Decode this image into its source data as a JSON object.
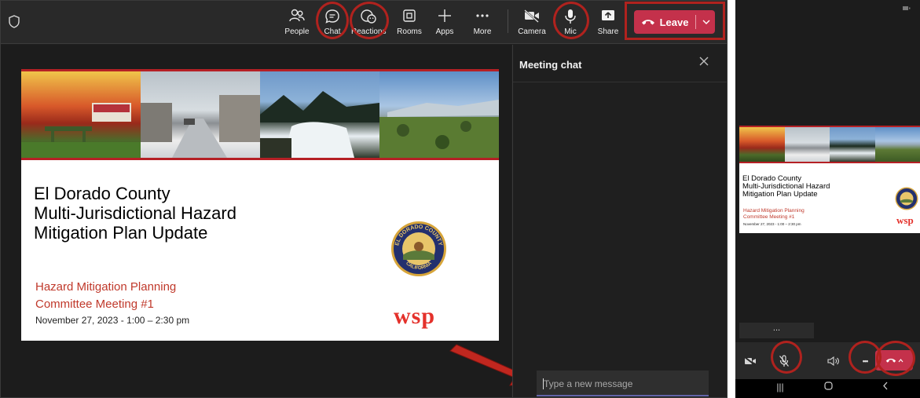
{
  "desktop": {
    "toolbar": {
      "people": "People",
      "chat": "Chat",
      "reactions": "Reactions",
      "rooms": "Rooms",
      "apps": "Apps",
      "more": "More",
      "camera": "Camera",
      "mic": "Mic",
      "share": "Share",
      "leave": "Leave"
    },
    "chat_panel": {
      "title": "Meeting chat",
      "placeholder": "Type a new message"
    },
    "slide": {
      "title_lines": [
        "El Dorado County",
        "Multi-Jurisdictional Hazard",
        "Mitigation Plan Update"
      ],
      "subtitle_lines": [
        "Hazard Mitigation Planning",
        "Committee Meeting #1"
      ],
      "date": "November 27, 2023 - 1:00 – 2:30 pm",
      "seal_top_text": "EL DORADO COUNTY",
      "seal_bottom_text": "CALIFORNIA",
      "logo": "wsp"
    }
  },
  "phone": {
    "slide": {
      "title_lines": [
        "El Dorado County",
        "Multi-Jurisdictional Hazard",
        "Mitigation Plan Update"
      ],
      "subtitle_lines": [
        "Hazard Mitigation Planning",
        "Committee Meeting #1"
      ],
      "date": "November 27, 2023 - 1:00 – 2:30 pm",
      "logo": "wsp"
    },
    "more_label": "...",
    "controls_more_label": "•••"
  },
  "colors": {
    "accent_red": "#c4314b",
    "annotation_red": "#b0221e",
    "slide_red": "#b52025",
    "wsp_red": "#e4312b",
    "teams_purple": "#6264a7"
  }
}
